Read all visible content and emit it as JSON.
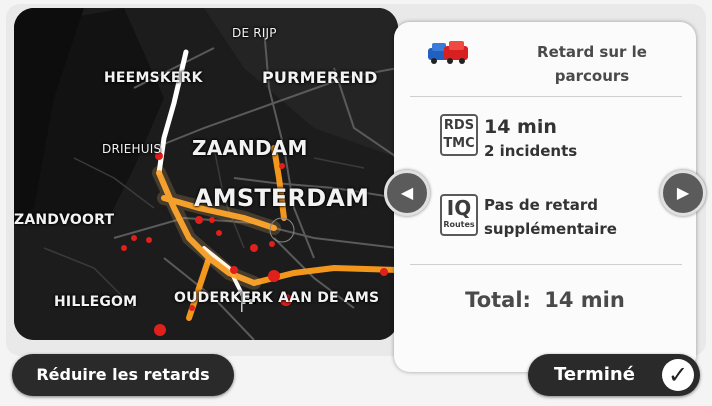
{
  "map": {
    "labels": {
      "de_rijp": "DE RIJP",
      "heemskerk": "HEEMSKERK",
      "purmerend": "PURMEREND",
      "driehuis": "DRIEHUIS",
      "zaandam": "ZAANDAM",
      "amsterdam": "AMSTERDAM",
      "zandvoort": "ZANDVOORT",
      "hillegom": "HILLEGOM",
      "ouderkerk": "OUDERKERK AAN DE AMS"
    }
  },
  "panel": {
    "title": "Retard sur le parcours",
    "rds_badge": {
      "line1": "RDS",
      "line2": "TMC"
    },
    "rds_time": "14 min",
    "rds_incidents": "2 incidents",
    "iq_badge": {
      "line1": "IQ",
      "line2": "Routes"
    },
    "iq_line1": "Pas de retard",
    "iq_line2": "supplémentaire",
    "total_label": "Total:",
    "total_value": "14 min"
  },
  "nav": {
    "prev_icon": "arrow-left-icon",
    "next_icon": "arrow-right-icon",
    "prev_glyph": "◀",
    "next_glyph": "▶"
  },
  "buttons": {
    "reduce_label": "Réduire les retards",
    "done_label": "Terminé",
    "done_icon": "checkmark-icon",
    "done_glyph": "✓"
  },
  "colors": {
    "traffic": "#ff9d1c",
    "incident": "#e0201a",
    "route": "#ffffff"
  }
}
